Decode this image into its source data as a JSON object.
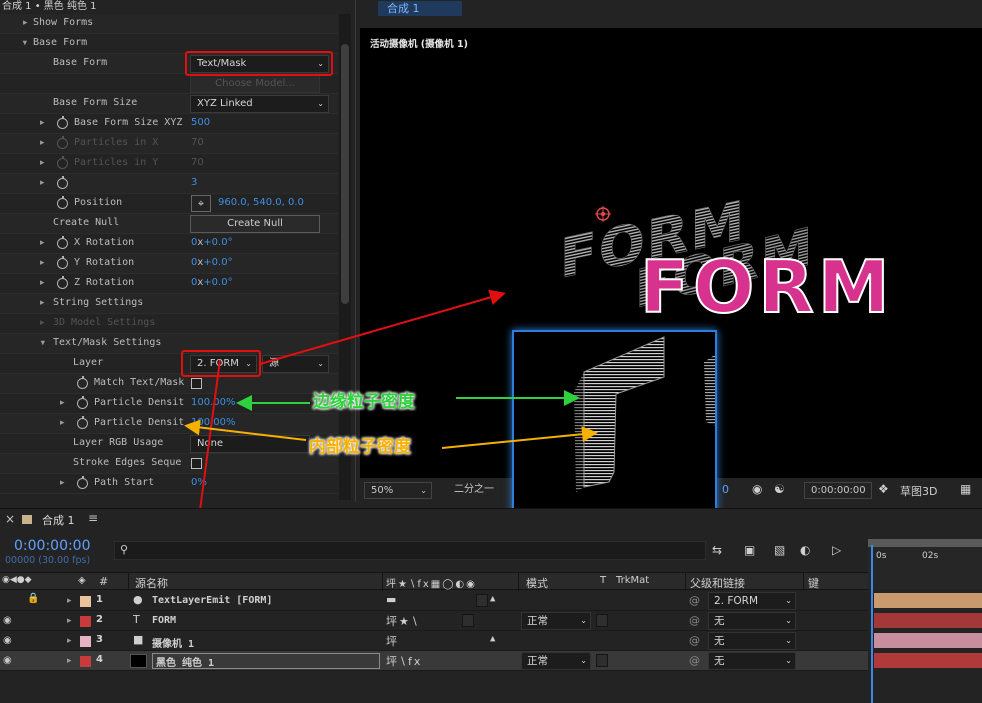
{
  "effect_panel": {
    "header": "合成 1 • 黑色 纯色 1",
    "rows": {
      "show_forms": "Show Forms",
      "base_form_group": "Base Form",
      "base_form_label": "Base Form",
      "base_form_value": "Text/Mask",
      "choose_model": "Choose Model...",
      "base_form_size_label": "Base Form Size",
      "base_form_size_value": "XYZ Linked",
      "size_xyz_label": "Base Form Size XYZ",
      "size_xyz_value": "500",
      "particles_x_label": "Particles in X",
      "particles_x_value": "70",
      "particles_y_label": "Particles in Y",
      "particles_y_value": "70",
      "unnamed_value": "3",
      "position_label": "Position",
      "position_value": "960.0, 540.0, 0.0",
      "create_null_label": "Create Null",
      "create_null_button": "Create Null",
      "x_rot_label": "X Rotation",
      "y_rot_label": "Y Rotation",
      "z_rot_label": "Z Rotation",
      "rot_revs": "0",
      "rot_x": "x",
      "rot_deg": "+0.0°",
      "string_settings": "String Settings",
      "model_settings": "3D Model Settings",
      "text_mask_settings": "Text/Mask Settings",
      "layer_label": "Layer",
      "layer_value": "2. FORM",
      "layer_source": "源",
      "match_text_label": "Match Text/Mask",
      "density_edge_label": "Particle Densit",
      "density_edge_value": "100.00%",
      "density_inner_label": "Particle Densit",
      "density_inner_value": "100.00%",
      "rgb_usage_label": "Layer RGB Usage",
      "rgb_usage_value": "None",
      "stroke_edges_label": "Stroke Edges Seque",
      "path_start_label": "Path Start",
      "path_start_value": "0%"
    }
  },
  "comp_panel": {
    "tab": "合成 1",
    "viewer_label": "活动摄像机 (摄像机 1)",
    "form_text": "FORM",
    "bottom_bar": {
      "zoom": "50%",
      "resolution": "二分之一",
      "frame_fragment": "0",
      "timecode": "0:00:00:00",
      "renderer": "草图3D"
    }
  },
  "annotations": {
    "edge_density": "边缘粒子密度",
    "inner_density": "内部粒子密度"
  },
  "timeline": {
    "tab": "合成 1",
    "current_time": "0:00:00:00",
    "fps": "00000 (30.00 fps)",
    "headers": {
      "num": "#",
      "source_name": "源名称",
      "mode": "模式",
      "t": "T",
      "trkmat": "TrkMat",
      "parent": "父级和链接",
      "keys": "键"
    },
    "ruler": {
      "t0": "0s",
      "t2": "02s"
    },
    "layers": [
      {
        "num": "1",
        "name": "TextLayerEmit [FORM]",
        "color": "#e8c39e",
        "type_icon": "bulb-icon",
        "mode": "",
        "parent": "2. FORM"
      },
      {
        "num": "2",
        "name": "FORM",
        "color": "#c83b3b",
        "type_icon": "text-icon",
        "mode": "正常",
        "parent": "无"
      },
      {
        "num": "3",
        "name": "摄像机 1",
        "color": "#e6b3c3",
        "type_icon": "camera-icon",
        "mode": "",
        "parent": "无"
      },
      {
        "num": "4",
        "name": "黑色 纯色 1",
        "color": "#c83b3b",
        "type_icon": "solid-icon",
        "mode": "正常",
        "parent": "无"
      }
    ]
  },
  "colors": {
    "accent_blue": "#3d8fe5",
    "highlight_red": "#e10f0f",
    "annotation_green": "#2fd13c",
    "annotation_orange": "#f6b100",
    "form_magenta": "#d8328f"
  }
}
